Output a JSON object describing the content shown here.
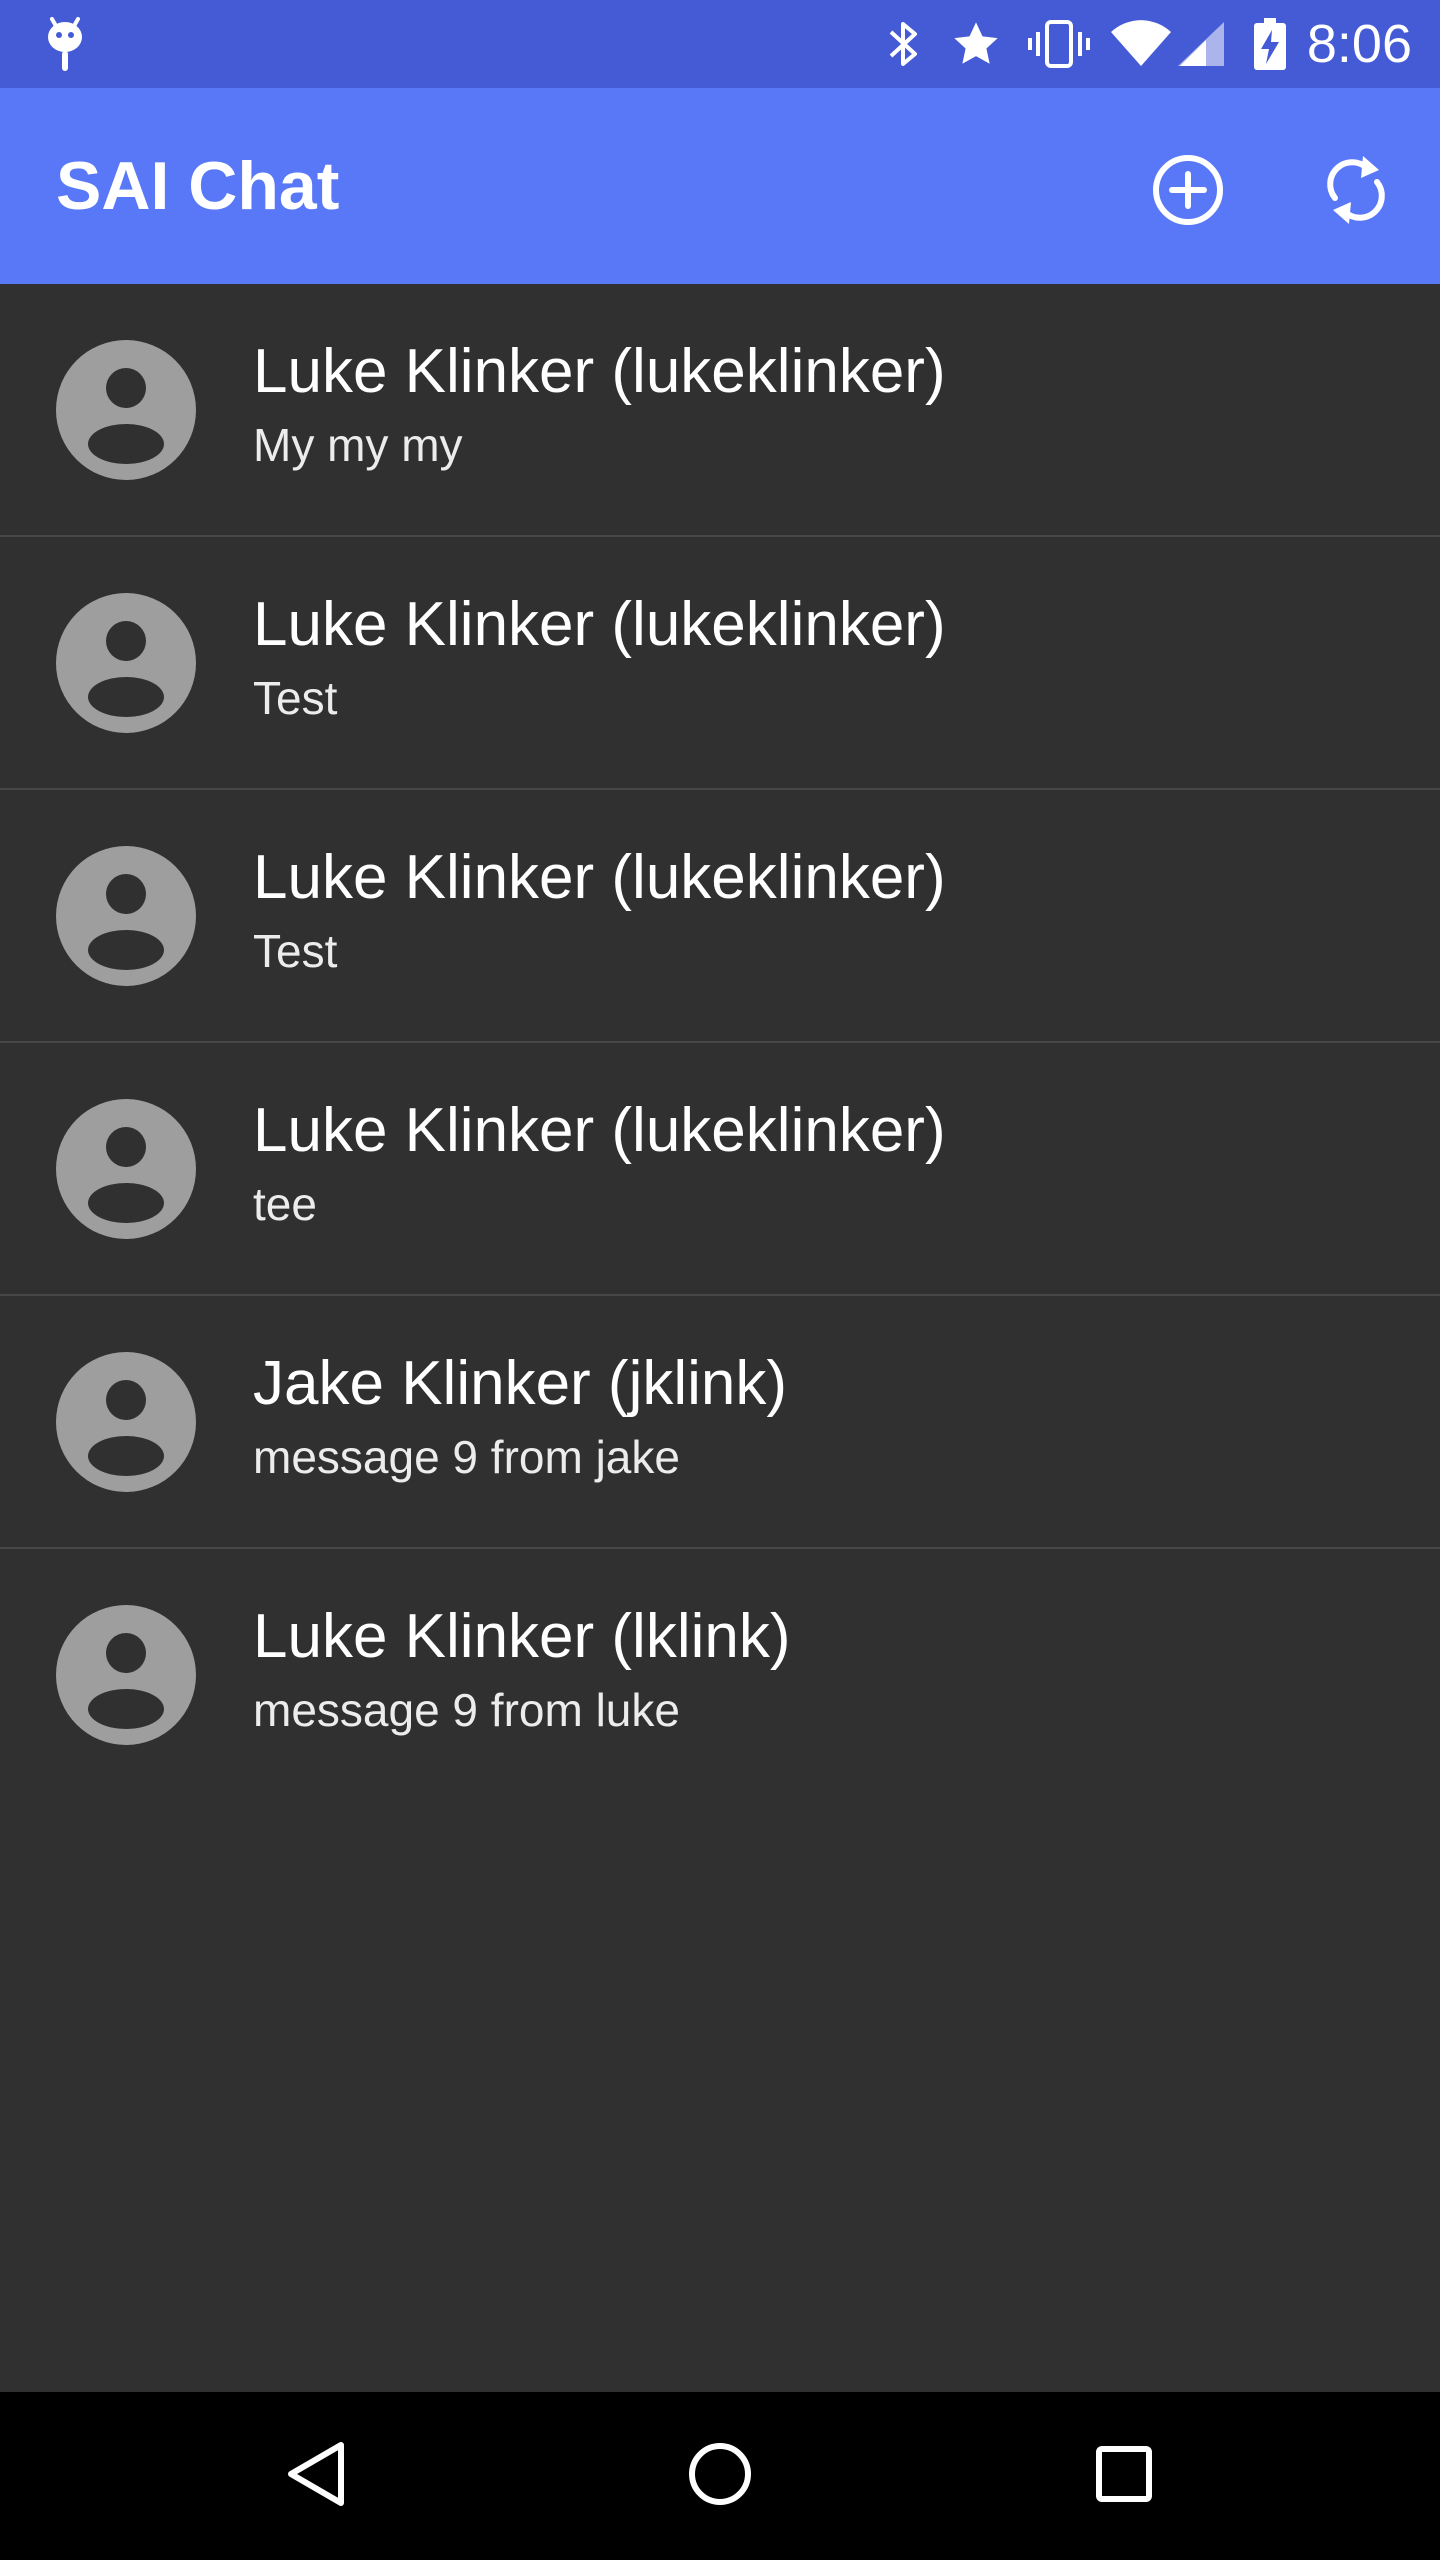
{
  "status_bar": {
    "time": "8:06",
    "icons": [
      "android-debug-icon",
      "bluetooth-icon",
      "star-icon",
      "vibrate-icon",
      "wifi-icon",
      "cell-signal-icon",
      "battery-charging-icon"
    ],
    "background_color": "#455BD6"
  },
  "app_bar": {
    "title": "SAI Chat",
    "background_color": "#5978F7",
    "actions": [
      "add-circle-icon",
      "refresh-icon"
    ]
  },
  "conversations": [
    {
      "name": "Luke Klinker (lukeklinker)",
      "preview": "My my my"
    },
    {
      "name": "Luke Klinker (lukeklinker)",
      "preview": "Test"
    },
    {
      "name": "Luke Klinker (lukeklinker)",
      "preview": "Test"
    },
    {
      "name": "Luke Klinker (lukeklinker)",
      "preview": "tee"
    },
    {
      "name": "Jake Klinker (jklink)",
      "preview": "message 9 from jake"
    },
    {
      "name": "Luke Klinker (lklink)",
      "preview": "message 9 from luke"
    }
  ],
  "nav_bar": {
    "buttons": [
      "back-icon",
      "home-icon",
      "recents-icon"
    ]
  },
  "colors": {
    "list_background": "#303030",
    "divider": "#474747",
    "avatar": "#9E9E9E"
  }
}
